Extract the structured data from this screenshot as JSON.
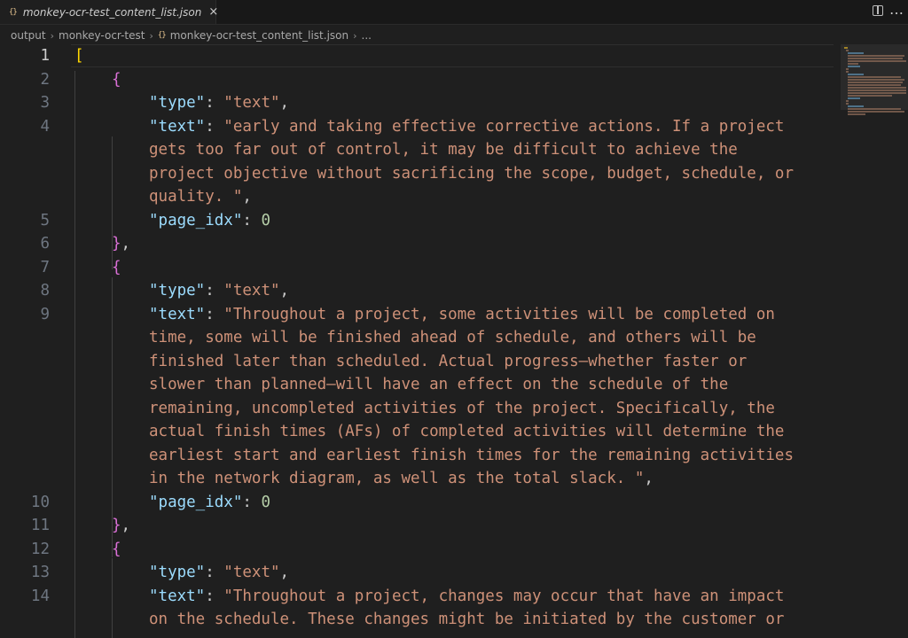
{
  "tab": {
    "icon": "{}",
    "label": "monkey-ocr-test_content_list.json",
    "close": "×"
  },
  "actions": {
    "split_icon": "split-editor-icon",
    "more_icon": "…"
  },
  "breadcrumb": {
    "items": [
      "output",
      "monkey-ocr-test",
      "monkey-ocr-test_content_list.json",
      "..."
    ],
    "file_icon": "{}"
  },
  "editor": {
    "current_line": 1,
    "line_numbers": [
      "1",
      "2",
      "3",
      "4",
      "5",
      "6",
      "7",
      "8",
      "9",
      "10",
      "11",
      "12",
      "13",
      "14"
    ],
    "lines": {
      "l1": "[",
      "l2": "{",
      "l3_key": "\"type\"",
      "l3_val": "\"text\"",
      "l4_key": "\"text\"",
      "l4_val_1": "\"early and taking effective corrective actions. If a project",
      "l4_val_2": "gets too far out of control, it may be difficult to achieve the",
      "l4_val_3": "project objective without sacrificing the scope, budget, schedule, or",
      "l4_val_4": "quality. \"",
      "l5_key": "\"page_idx\"",
      "l5_val": "0",
      "l6": "}",
      "l7": "{",
      "l8_key": "\"type\"",
      "l8_val": "\"text\"",
      "l9_key": "\"text\"",
      "l9_val_1": "\"Throughout a project, some activities will be completed on",
      "l9_val_2": "time, some will be finished ahead of schedule, and others will be",
      "l9_val_3": "finished later than scheduled. Actual progress—whether faster or",
      "l9_val_4": "slower than planned—will have an effect on the schedule of the",
      "l9_val_5": "remaining, uncompleted activities of the project. Specifically, the",
      "l9_val_6": "actual finish times (AFs) of completed activities will determine the",
      "l9_val_7": "earliest start and earliest finish times for the remaining activities",
      "l9_val_8": "in the network diagram, as well as the total slack. \"",
      "l10_key": "\"page_idx\"",
      "l10_val": "0",
      "l11": "}",
      "l12": "{",
      "l13_key": "\"type\"",
      "l13_val": "\"text\"",
      "l14_key": "\"text\"",
      "l14_val_1": "\"Throughout a project, changes may occur that have an impact",
      "l14_val_2": "on the schedule. These changes might be initiated by the customer or"
    }
  },
  "colors": {
    "background": "#1f1f1f",
    "key": "#9cdcfe",
    "string": "#ce9178",
    "number": "#b5cea8",
    "bracket_outer": "#ffd700",
    "bracket_inner": "#da70d6"
  }
}
